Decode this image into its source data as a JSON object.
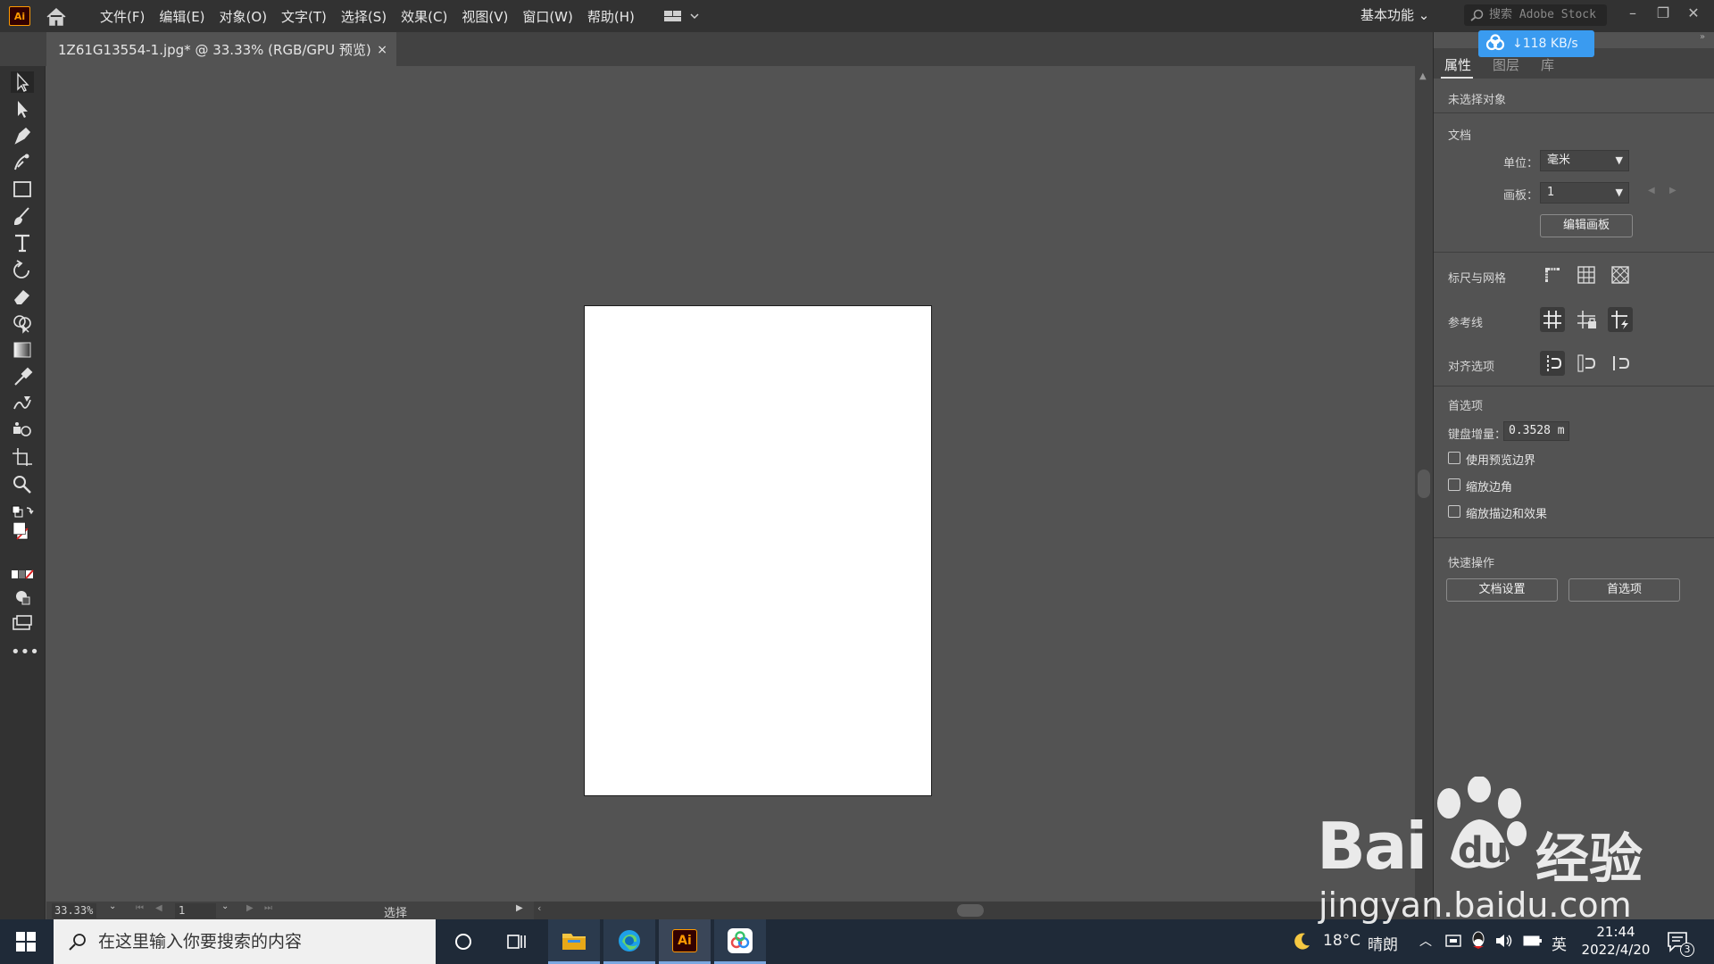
{
  "app": {
    "logo_text": "Ai",
    "menu": [
      "文件(F)",
      "编辑(E)",
      "对象(O)",
      "文字(T)",
      "选择(S)",
      "效果(C)",
      "视图(V)",
      "窗口(W)",
      "帮助(H)"
    ],
    "workspace": "基本功能",
    "stock_search_placeholder": "搜索 Adobe Stock"
  },
  "document_tab": {
    "title": "1Z61G13554-1.jpg* @ 33.33% (RGB/GPU 预览)",
    "close": "×"
  },
  "statusbar": {
    "zoom": "33.33%",
    "page": "1",
    "tool_status": "选择"
  },
  "download_badge": {
    "speed": "↓118 KB/s"
  },
  "panel": {
    "tabs": [
      "属性",
      "图层",
      "库"
    ],
    "active_tab": "属性",
    "no_selection": "未选择对象",
    "document": {
      "title": "文档",
      "unit_label": "单位：",
      "unit_value": "毫米",
      "artboard_label": "画板：",
      "artboard_value": "1",
      "edit_artboard": "编辑画板"
    },
    "rulers_grids": "标尺与网格",
    "guides": "参考线",
    "snap_options": "对齐选项",
    "preferences": {
      "title": "首选项",
      "keyboard_increment_label": "键盘增量：",
      "keyboard_increment_value": "0.3528 m",
      "checkboxes": [
        "使用预览边界",
        "缩放边角",
        "缩放描边和效果"
      ]
    },
    "quick_actions": {
      "title": "快速操作",
      "doc_setup": "文档设置",
      "prefs": "首选项"
    }
  },
  "taskbar": {
    "search_placeholder": "在这里输入你要搜索的内容",
    "weather_temp": "18°C",
    "weather_desc": "晴朗",
    "ime": "英",
    "time": "21:44",
    "date": "2022/4/20",
    "notif_count": "3",
    "ai_label": "Ai"
  },
  "watermark": {
    "brand": "Bai",
    "brand2": "du",
    "cn": "经验",
    "url": "jingyan.baidu.com"
  },
  "colors": {
    "ui_dark": "#323232",
    "ui_mid": "#535353",
    "ai_orange": "#ff9a00",
    "badge_blue": "#3a9bf0"
  }
}
